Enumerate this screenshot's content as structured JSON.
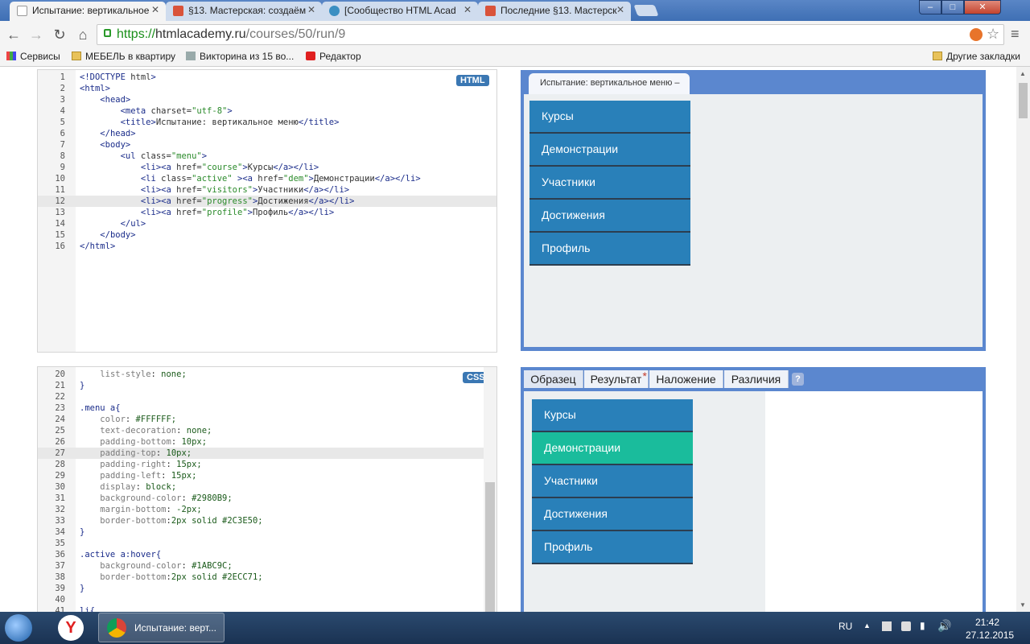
{
  "browser": {
    "tabs": [
      {
        "title": "Испытание: вертикальное",
        "active": true
      },
      {
        "title": "§13. Мастерская: создаём",
        "active": false
      },
      {
        "title": "[Сообщество HTML Acad",
        "active": false
      },
      {
        "title": "Последние §13. Мастерск",
        "active": false
      }
    ],
    "window_buttons": {
      "minimize": "–",
      "maximize": "□",
      "close": "✕"
    },
    "nav": {
      "back": "←",
      "forward": "→",
      "reload": "↻",
      "home": "⌂"
    },
    "url": {
      "scheme": "https://",
      "host": "htmlacademy.ru",
      "path": "/courses/50/run/9"
    },
    "bookmarks": [
      "Сервисы",
      "МЕБЕЛЬ в квартиру",
      "Викторина из 15 во...",
      "Редактор"
    ],
    "other_bookmarks": "Другие закладки"
  },
  "html_editor": {
    "badge": "HTML",
    "lines": [
      {
        "n": "1",
        "code": "<!DOCTYPE html>"
      },
      {
        "n": "2",
        "code": "<html>"
      },
      {
        "n": "3",
        "code": "    <head>"
      },
      {
        "n": "4",
        "code": "        <meta charset=\"utf-8\">"
      },
      {
        "n": "5",
        "code": "        <title>Испытание: вертикальное меню</title>"
      },
      {
        "n": "6",
        "code": "    </head>"
      },
      {
        "n": "7",
        "code": "    <body>"
      },
      {
        "n": "8",
        "code": "        <ul class=\"menu\">"
      },
      {
        "n": "9",
        "code": "            <li><a href=\"course\">Курсы</a></li>"
      },
      {
        "n": "10",
        "code": "            <li class=\"active\" ><a href=\"dem\">Демонстрации</a></li>"
      },
      {
        "n": "11",
        "code": "            <li><a href=\"visitors\">Участники</a></li>"
      },
      {
        "n": "12",
        "code": "            <li><a href=\"progress\">Достижения</a></li>"
      },
      {
        "n": "13",
        "code": "            <li><a href=\"profile\">Профиль</a></li>"
      },
      {
        "n": "14",
        "code": "        </ul>"
      },
      {
        "n": "15",
        "code": "    </body>"
      },
      {
        "n": "16",
        "code": "</html>"
      }
    ],
    "highlighted_line": "12"
  },
  "css_editor": {
    "badge": "CSS",
    "lines": [
      {
        "n": "20",
        "code": "    list-style: none;"
      },
      {
        "n": "21",
        "code": "}"
      },
      {
        "n": "22",
        "code": ""
      },
      {
        "n": "23",
        "code": ".menu a{"
      },
      {
        "n": "24",
        "code": "    color: #FFFFFF;"
      },
      {
        "n": "25",
        "code": "    text-decoration: none;"
      },
      {
        "n": "26",
        "code": "    padding-bottom: 10px;"
      },
      {
        "n": "27",
        "code": "    padding-top: 10px;"
      },
      {
        "n": "28",
        "code": "    padding-right: 15px;"
      },
      {
        "n": "29",
        "code": "    padding-left: 15px;"
      },
      {
        "n": "30",
        "code": "    display: block;"
      },
      {
        "n": "31",
        "code": "    background-color: #2980B9;"
      },
      {
        "n": "32",
        "code": "    margin-bottom: -2px;"
      },
      {
        "n": "33",
        "code": "    border-bottom:2px solid #2C3E50;"
      },
      {
        "n": "34",
        "code": "}"
      },
      {
        "n": "35",
        "code": ""
      },
      {
        "n": "36",
        "code": ".active a:hover{"
      },
      {
        "n": "37",
        "code": "    background-color: #1ABC9C;"
      },
      {
        "n": "38",
        "code": "    border-bottom:2px solid #2ECC71;"
      },
      {
        "n": "39",
        "code": "}"
      },
      {
        "n": "40",
        "code": ""
      },
      {
        "n": "41",
        "code": "li{"
      }
    ],
    "highlighted_line": "27"
  },
  "preview_top": {
    "tab_title": "Испытание: вертикальное меню –",
    "menu": [
      "Курсы",
      "Демонстрации",
      "Участники",
      "Достижения",
      "Профиль"
    ]
  },
  "preview_bottom": {
    "tabs": [
      "Образец",
      "Результат",
      "Наложение",
      "Различия"
    ],
    "result_marker": "*",
    "help": "?",
    "menu": [
      "Курсы",
      "Демонстрации",
      "Участники",
      "Достижения",
      "Профиль"
    ],
    "active_index": 1
  },
  "colors": {
    "menu_bg": "#2980B9",
    "menu_border": "#2C3E50",
    "active_bg": "#1ABC9C",
    "frame": "#5B87CF"
  },
  "taskbar": {
    "app_label": "Испытание: верт...",
    "lang": "RU",
    "time": "21:42",
    "date": "27.12.2015"
  }
}
